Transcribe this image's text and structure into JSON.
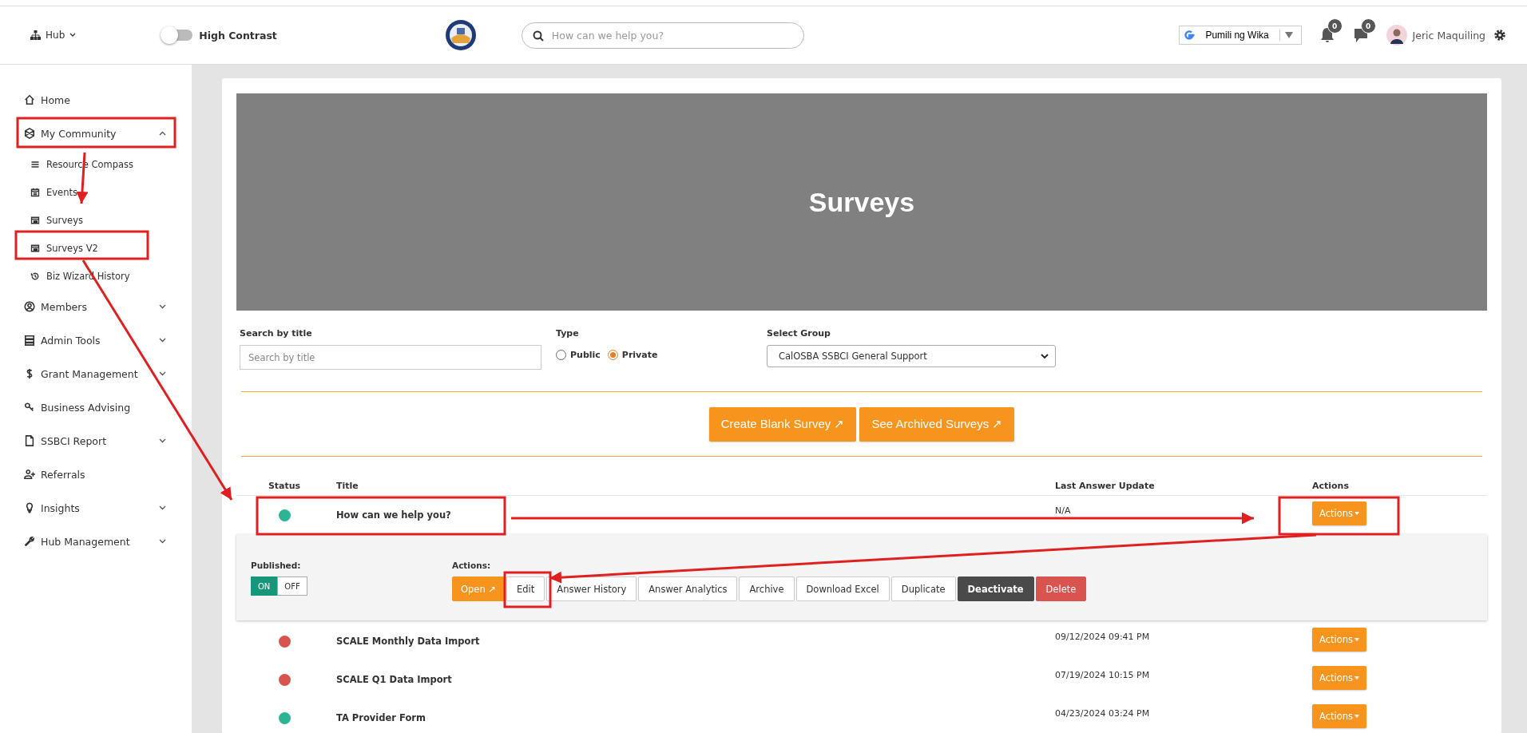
{
  "header": {
    "hub_menu": "Hub",
    "high_contrast": {
      "label": "High Contrast",
      "on": false
    },
    "search": {
      "placeholder": "How can we help you?"
    },
    "language": "Pumili ng Wika",
    "notifications": "0",
    "messages": "0",
    "user": "Jeric Maquiling"
  },
  "sidebar": {
    "items": [
      {
        "kind": "home",
        "label": "Home"
      },
      {
        "kind": "community",
        "label": "My Community",
        "expanded": true,
        "children": [
          {
            "kind": "list",
            "label": "Resource Compass"
          },
          {
            "kind": "calendar",
            "label": "Events"
          },
          {
            "kind": "table",
            "label": "Surveys"
          },
          {
            "kind": "table",
            "label": "Surveys V2"
          },
          {
            "kind": "history",
            "label": "Biz Wizard History"
          }
        ]
      },
      {
        "kind": "user",
        "label": "Members",
        "expanded": false
      },
      {
        "kind": "server",
        "label": "Admin Tools",
        "expanded": false
      },
      {
        "kind": "dollar",
        "label": "Grant Management",
        "expanded": false
      },
      {
        "kind": "key",
        "label": "Business Advising"
      },
      {
        "kind": "file",
        "label": "SSBCI Report",
        "expanded": false
      },
      {
        "kind": "userplus",
        "label": "Referrals"
      },
      {
        "kind": "bulb",
        "label": "Insights",
        "expanded": false
      },
      {
        "kind": "wrench",
        "label": "Hub Management",
        "expanded": false
      }
    ]
  },
  "banner": {
    "title": "Surveys"
  },
  "filters": {
    "search": {
      "label": "Search by title",
      "placeholder": "Search by title"
    },
    "type": {
      "label": "Type",
      "options": [
        {
          "label": "Public",
          "selected": false
        },
        {
          "label": "Private",
          "selected": true
        }
      ]
    },
    "group": {
      "label": "Select Group",
      "value": "CalOSBA SSBCI General Support"
    }
  },
  "buttons": [
    "Create Blank Survey ↗",
    "See Archived Surveys ↗"
  ],
  "table": {
    "columns": [
      "Status",
      "Title",
      "Last Answer Update",
      "Actions"
    ],
    "rows": [
      {
        "color": "#2bb594",
        "title": "How can we help you?",
        "last_update": "N/A",
        "action": "Actions",
        "details": {
          "published_label": "Published:",
          "toggle": [
            {
              "label": "ON",
              "selected": true
            },
            {
              "label": "OFF",
              "selected": false
            }
          ],
          "actions_label": "Actions:",
          "actions": [
            {
              "kind": "primary",
              "label": "Open ↗"
            },
            {
              "kind": "default",
              "label": "Edit"
            },
            {
              "kind": "default",
              "label": "Answer History"
            },
            {
              "kind": "default",
              "label": "Answer Analytics"
            },
            {
              "kind": "default",
              "label": "Archive"
            },
            {
              "kind": "default",
              "label": "Download Excel"
            },
            {
              "kind": "default",
              "label": "Duplicate"
            },
            {
              "kind": "dark",
              "label": "Deactivate"
            },
            {
              "kind": "danger",
              "label": "Delete"
            }
          ]
        }
      },
      {
        "color": "#d9534f",
        "title": "SCALE Monthly Data Import",
        "last_update": "09/12/2024 09:41 PM",
        "action": "Actions"
      },
      {
        "color": "#d9534f",
        "title": "SCALE Q1 Data Import",
        "last_update": "07/19/2024 10:15 PM",
        "action": "Actions"
      },
      {
        "color": "#2bb594",
        "title": "TA Provider Form",
        "last_update": "04/23/2024 03:24 PM",
        "action": "Actions"
      }
    ]
  }
}
